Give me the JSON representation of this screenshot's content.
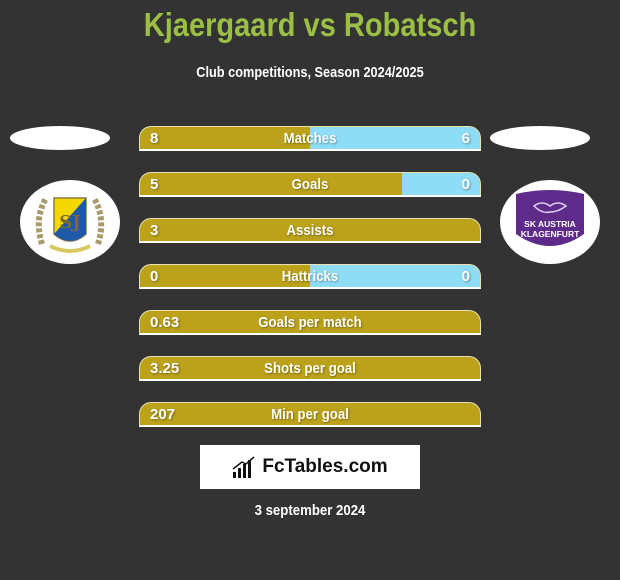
{
  "header": {
    "title": "Kjaergaard vs Robatsch",
    "subtitle": "Club competitions, Season 2024/2025"
  },
  "teams": {
    "left": {
      "logo": "crest-laurel-yellow-blue",
      "colors": [
        "#f5d800",
        "#1e5aa8"
      ]
    },
    "right": {
      "logo_text_1": "SK AUSTRIA",
      "logo_text_2": "KLAGENFURT",
      "color": "#5e2b8a"
    }
  },
  "colors": {
    "left_bar": "#bba21a",
    "right_bar": "#8fdcf6",
    "title": "#9bbf44",
    "background": "#333333"
  },
  "stats": [
    {
      "label": "Matches",
      "left": "8",
      "right": "6",
      "right_share": 0.5
    },
    {
      "label": "Goals",
      "left": "5",
      "right": "0",
      "right_share": 0.23
    },
    {
      "label": "Assists",
      "left": "3",
      "right": "",
      "right_share": 0
    },
    {
      "label": "Hattricks",
      "left": "0",
      "right": "0",
      "right_share": 0.5
    },
    {
      "label": "Goals per match",
      "left": "0.63",
      "right": "",
      "right_share": 0
    },
    {
      "label": "Shots per goal",
      "left": "3.25",
      "right": "",
      "right_share": 0
    },
    {
      "label": "Min per goal",
      "left": "207",
      "right": "",
      "right_share": 0
    }
  ],
  "footer": {
    "brand": "FcTables.com",
    "date": "3 september 2024"
  }
}
